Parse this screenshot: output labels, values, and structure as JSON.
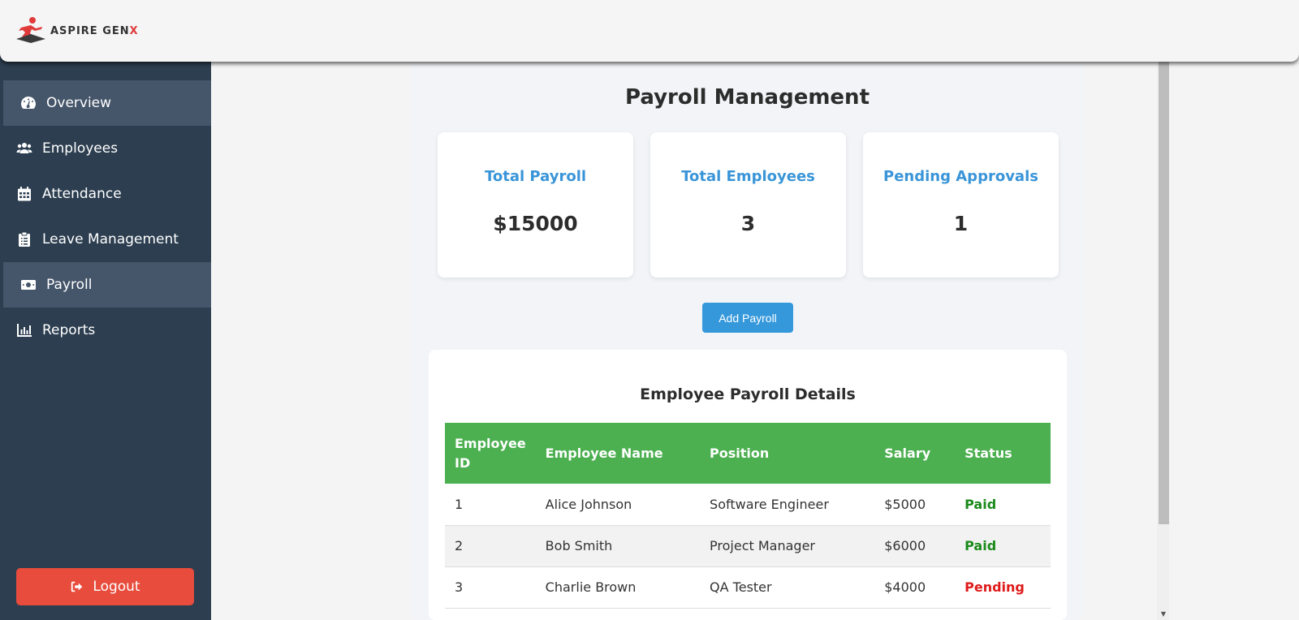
{
  "brand": {
    "name_main": "ASPIRE GEN",
    "name_accent": "X"
  },
  "sidebar": {
    "items": [
      {
        "label": "Overview",
        "icon": "dashboard-icon",
        "active": true
      },
      {
        "label": "Employees",
        "icon": "users-icon",
        "active": false
      },
      {
        "label": "Attendance",
        "icon": "calendar-icon",
        "active": false
      },
      {
        "label": "Leave Management",
        "icon": "clipboard-icon",
        "active": false
      },
      {
        "label": "Payroll",
        "icon": "money-icon",
        "active": true
      },
      {
        "label": "Reports",
        "icon": "chart-icon",
        "active": false
      }
    ],
    "logout_label": "Logout"
  },
  "main": {
    "title": "Payroll Management",
    "cards": [
      {
        "title": "Total Payroll",
        "value": "$15000"
      },
      {
        "title": "Total Employees",
        "value": "3"
      },
      {
        "title": "Pending Approvals",
        "value": "1"
      }
    ],
    "add_button_label": "Add Payroll",
    "table": {
      "title": "Employee Payroll Details",
      "headers": [
        "Employee ID",
        "Employee Name",
        "Position",
        "Salary",
        "Status"
      ],
      "rows": [
        {
          "id": "1",
          "name": "Alice Johnson",
          "position": "Software Engineer",
          "salary": "$5000",
          "status": "Paid"
        },
        {
          "id": "2",
          "name": "Bob Smith",
          "position": "Project Manager",
          "salary": "$6000",
          "status": "Paid"
        },
        {
          "id": "3",
          "name": "Charlie Brown",
          "position": "QA Tester",
          "salary": "$4000",
          "status": "Pending"
        }
      ]
    }
  },
  "colors": {
    "sidebar_bg": "#2c3e50",
    "accent_blue": "#3498db",
    "table_header": "#4caf50",
    "logout_red": "#e74c3c",
    "paid_green": "#1a8a1a",
    "pending_red": "#e01a1a"
  }
}
